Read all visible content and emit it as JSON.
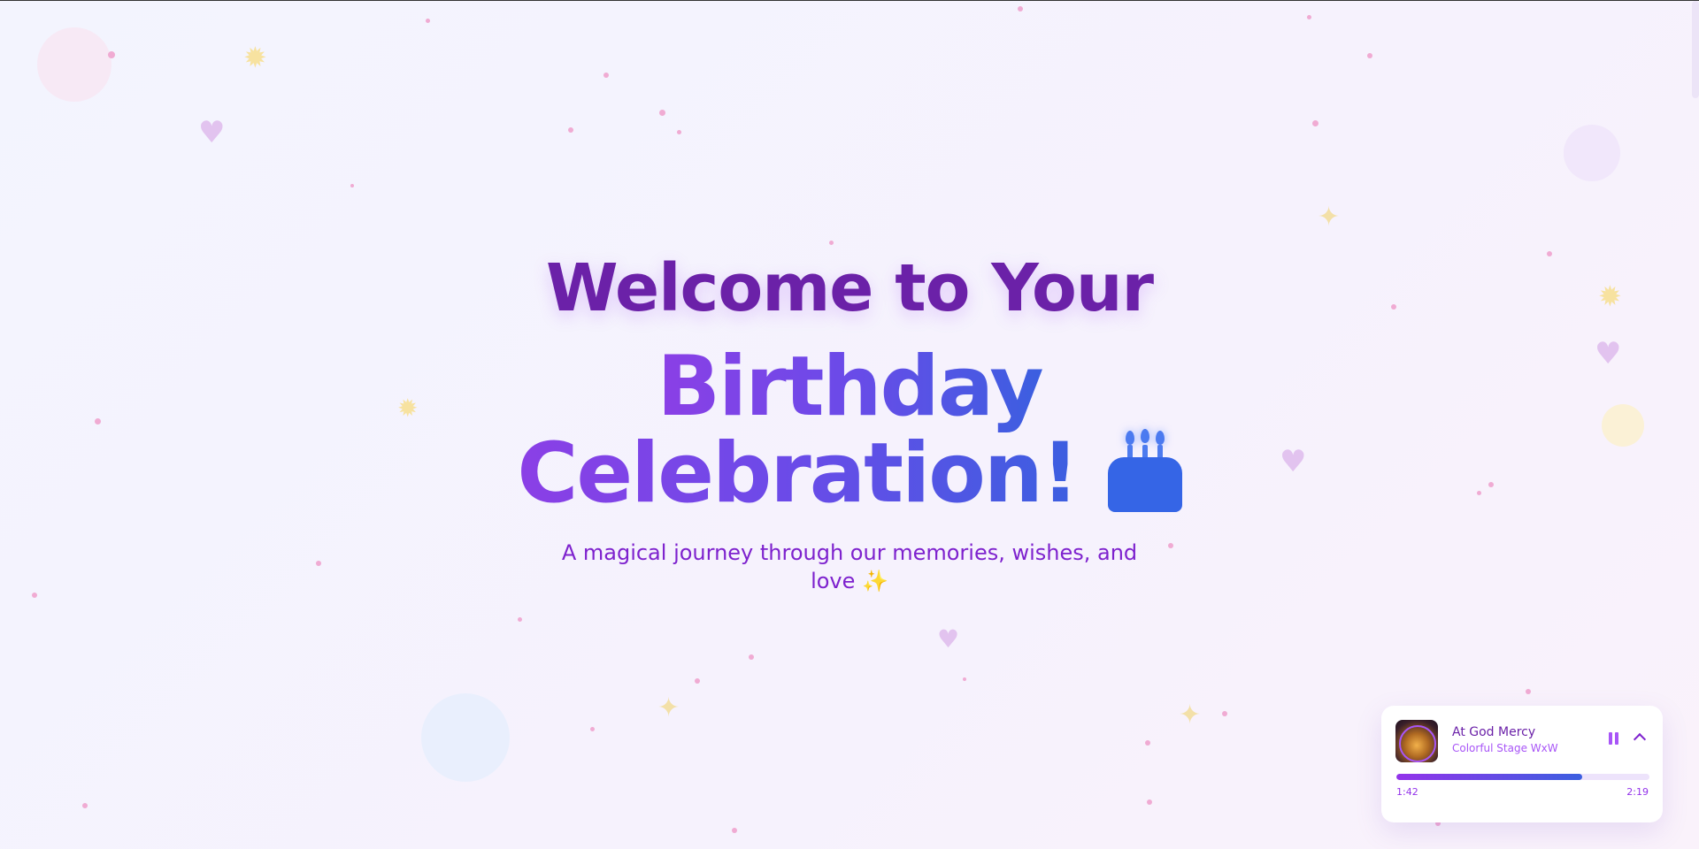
{
  "hero": {
    "welcome": "Welcome to Your",
    "title_line1": "Birthday",
    "title_line2": "Celebration!",
    "subtitle": "A magical journey through our memories, wishes, and love ✨"
  },
  "icons": {
    "cake": "birthday-cake-icon",
    "heart": "heart-icon",
    "sparkle": "sparkles-icon",
    "burst": "sparkle-burst-icon"
  },
  "music_player": {
    "track_title": "At God Mercy",
    "artist": "Colorful Stage WxW",
    "current_time": "1:42",
    "duration": "2:19",
    "progress": 0.734
  },
  "colors": {
    "accent_purple": "#7e22ce",
    "accent_blue": "#3b5fe0",
    "heading": "#6b21a8"
  }
}
